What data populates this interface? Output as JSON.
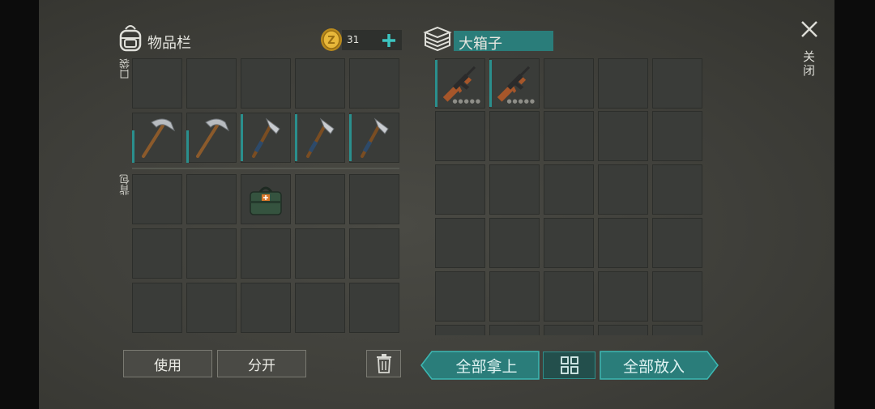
{
  "inventory": {
    "title": "物品栏",
    "icon": "backpack-icon",
    "coins": {
      "icon": "gold-coin-icon",
      "count": "31",
      "add_icon": "plus-icon"
    },
    "pocket_label": "口袋",
    "backpack_label": "背包"
  },
  "container": {
    "title": "大箱子",
    "icon": "storage-box-icon"
  },
  "close": {
    "label": "关闭",
    "icon": "close-x-icon"
  },
  "actions": {
    "use": "使用",
    "split": "分开",
    "delete_icon": "trash-icon",
    "take_all": "全部拿上",
    "sort_icon": "sort-grid-icon",
    "put_all": "全部放入"
  },
  "items": {
    "pocket": [
      "empty",
      "empty",
      "empty",
      "empty",
      "empty",
      "pickaxe",
      "pickaxe",
      "hatchet",
      "hatchet",
      "hatchet"
    ],
    "backpack": [
      "empty",
      "empty",
      "first-aid-kit",
      "empty",
      "empty"
    ],
    "box": [
      "assault-rifle",
      "assault-rifle"
    ]
  },
  "colors": {
    "accent": "#2a8f8d",
    "slot": "#3a3c39",
    "panel": "#44443f"
  }
}
